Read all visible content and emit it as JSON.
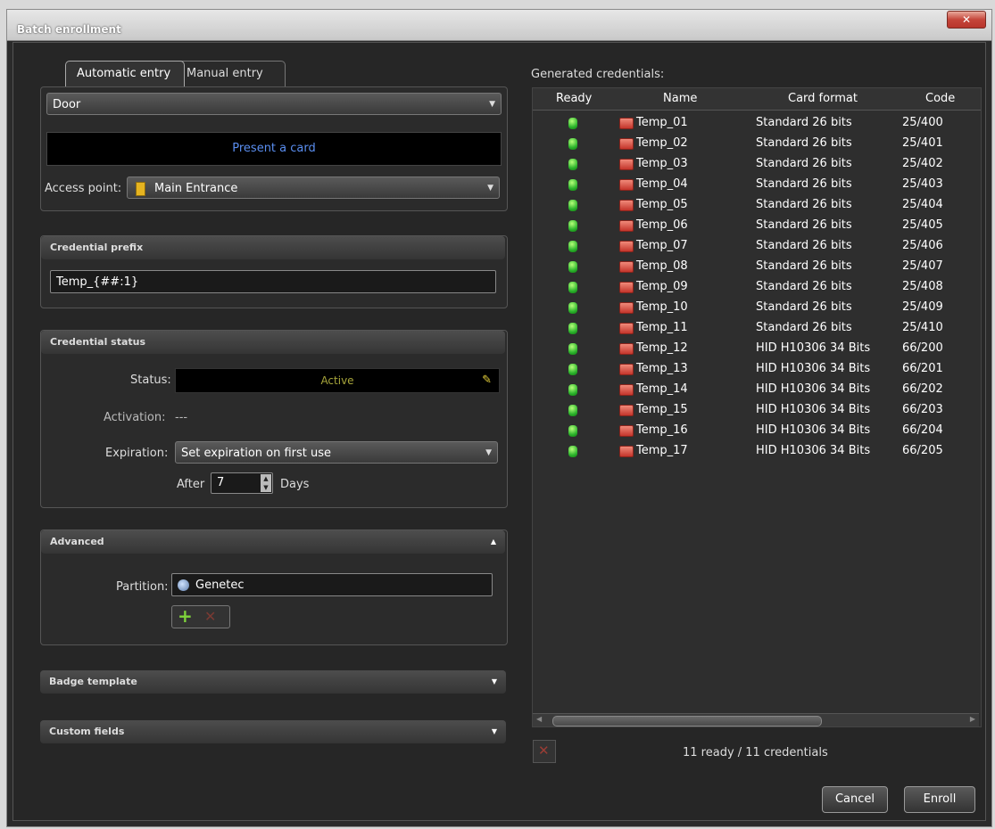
{
  "window": {
    "title": "Batch enrollment",
    "close_glyph": "✕"
  },
  "tabs": {
    "automatic": "Automatic entry",
    "manual": "Manual entry"
  },
  "reader": {
    "door_value": "Door",
    "present_prompt": "Present a card",
    "access_point_label": "Access point:",
    "access_point_value": "Main Entrance"
  },
  "credential_prefix": {
    "header": "Credential prefix",
    "value": "Temp_{##:1}"
  },
  "credential_status": {
    "header": "Credential status",
    "status_label": "Status:",
    "status_value": "Active",
    "activation_label": "Activation:",
    "activation_value": "---",
    "expiration_label": "Expiration:",
    "expiration_value": "Set expiration on first use",
    "after_label": "After",
    "after_value": "7",
    "days_label": "Days"
  },
  "advanced": {
    "header": "Advanced",
    "partition_label": "Partition:",
    "partition_value": "Genetec"
  },
  "badge_template": {
    "header": "Badge template"
  },
  "custom_fields": {
    "header": "Custom fields"
  },
  "grid": {
    "caption": "Generated credentials:",
    "columns": [
      "Ready",
      "Name",
      "Card format",
      "Code"
    ],
    "rows": [
      {
        "name": "Temp_01",
        "format": "Standard 26 bits",
        "code": "25/400"
      },
      {
        "name": "Temp_02",
        "format": "Standard 26 bits",
        "code": "25/401"
      },
      {
        "name": "Temp_03",
        "format": "Standard 26 bits",
        "code": "25/402"
      },
      {
        "name": "Temp_04",
        "format": "Standard 26 bits",
        "code": "25/403"
      },
      {
        "name": "Temp_05",
        "format": "Standard 26 bits",
        "code": "25/404"
      },
      {
        "name": "Temp_06",
        "format": "Standard 26 bits",
        "code": "25/405"
      },
      {
        "name": "Temp_07",
        "format": "Standard 26 bits",
        "code": "25/406"
      },
      {
        "name": "Temp_08",
        "format": "Standard 26 bits",
        "code": "25/407"
      },
      {
        "name": "Temp_09",
        "format": "Standard 26 bits",
        "code": "25/408"
      },
      {
        "name": "Temp_10",
        "format": "Standard 26 bits",
        "code": "25/409"
      },
      {
        "name": "Temp_11",
        "format": "Standard 26 bits",
        "code": "25/410"
      },
      {
        "name": "Temp_12",
        "format": "HID H10306 34 Bits",
        "code": "66/200"
      },
      {
        "name": "Temp_13",
        "format": "HID H10306 34 Bits",
        "code": "66/201"
      },
      {
        "name": "Temp_14",
        "format": "HID H10306 34 Bits",
        "code": "66/202"
      },
      {
        "name": "Temp_15",
        "format": "HID H10306 34 Bits",
        "code": "66/203"
      },
      {
        "name": "Temp_16",
        "format": "HID H10306 34 Bits",
        "code": "66/204"
      },
      {
        "name": "Temp_17",
        "format": "HID H10306 34 Bits",
        "code": "66/205"
      }
    ],
    "summary": "11 ready / 11 credentials"
  },
  "buttons": {
    "cancel": "Cancel",
    "enroll": "Enroll"
  }
}
